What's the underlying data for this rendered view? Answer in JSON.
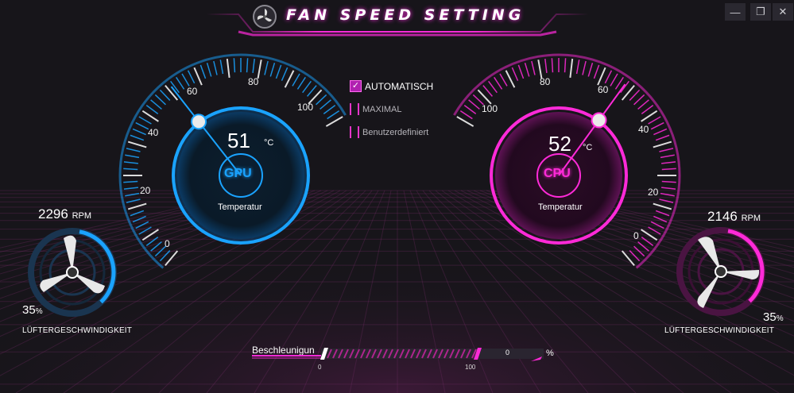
{
  "app": {
    "title": "FAN SPEED SETTING"
  },
  "window_controls": {
    "minimize": "—",
    "restore": "❐",
    "close": "✕"
  },
  "gpu": {
    "badge": "GPU",
    "temperature": "51",
    "temp_unit": "°C",
    "temp_label": "Temperatur",
    "scale_ticks": [
      "0",
      "20",
      "40",
      "60",
      "80",
      "100"
    ],
    "needle_value": 51,
    "accent_color": "#1aa3ff",
    "fan": {
      "rpm": "2296",
      "rpm_unit": "RPM",
      "percent": "35",
      "percent_unit": "%",
      "label": "LÜFTERGESCHWINDIGKEIT",
      "fill_fraction": 0.35
    }
  },
  "cpu": {
    "badge": "CPU",
    "temperature": "52",
    "temp_unit": "°C",
    "temp_label": "Temperatur",
    "scale_ticks": [
      "0",
      "20",
      "40",
      "60",
      "80",
      "100"
    ],
    "needle_value": 52,
    "accent_color": "#ff2ad8",
    "fan": {
      "rpm": "2146",
      "rpm_unit": "RPM",
      "percent": "35",
      "percent_unit": "%",
      "label": "LÜFTERGESCHWINDIGKEIT",
      "fill_fraction": 0.35
    }
  },
  "modes": {
    "automatic": {
      "label": "AUTOMATISCH",
      "checked": true
    },
    "maximum": {
      "label": "MAXIMAL",
      "checked": false
    },
    "custom": {
      "label": "Benutzerdefiniert",
      "checked": false
    }
  },
  "acceleration": {
    "label": "Beschleunigun",
    "value": "0",
    "unit": "%",
    "min_label": "0",
    "max_label": "100"
  }
}
